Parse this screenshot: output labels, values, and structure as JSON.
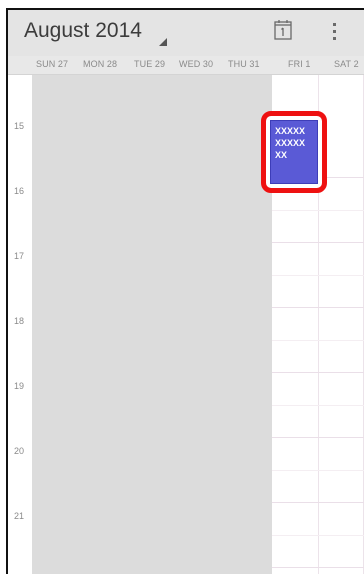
{
  "header": {
    "month_title": "August 2014"
  },
  "days": [
    {
      "label": "SUN 27"
    },
    {
      "label": "MON 28"
    },
    {
      "label": "TUE 29"
    },
    {
      "label": "WED 30"
    },
    {
      "label": "THU 31"
    },
    {
      "label": "FRI 1"
    },
    {
      "label": "SAT 2"
    }
  ],
  "hours": [
    "15",
    "16",
    "17",
    "18",
    "19",
    "20",
    "21"
  ],
  "event": {
    "line1": "XXXXX",
    "line2": "XXXXX",
    "line3": "XX"
  },
  "colors": {
    "event": "#5a5ad6",
    "highlight": "#ee1111",
    "past_area": "#dcdcdc"
  }
}
